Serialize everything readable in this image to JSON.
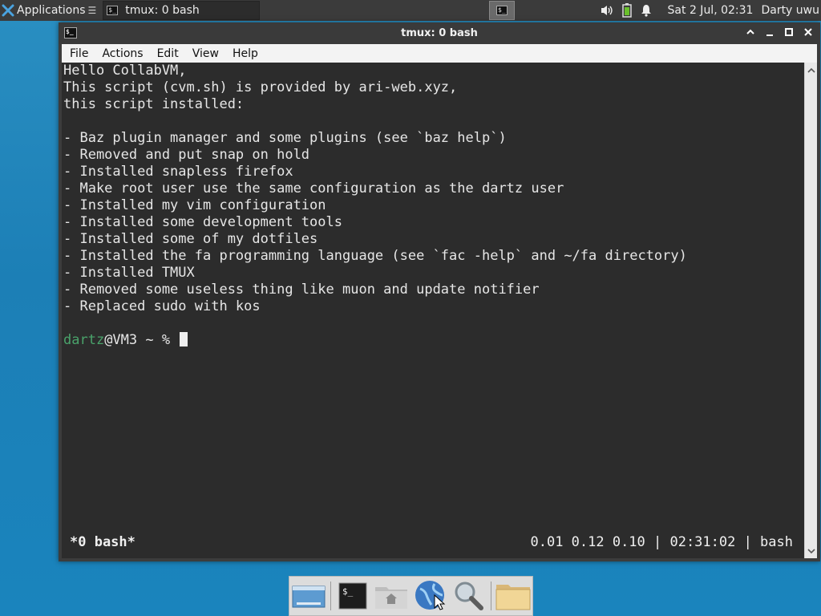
{
  "panel": {
    "applications_label": "Applications",
    "task_label": "tmux: 0 bash",
    "clock": "Sat  2 Jul, 02:31",
    "user": "Darty uwu",
    "tray_icons": [
      "volume-icon",
      "battery-icon",
      "notification-bell-icon"
    ]
  },
  "window": {
    "title": "tmux: 0 bash",
    "controls": [
      "shade-up-icon",
      "minimize-icon",
      "maximize-icon",
      "close-icon"
    ],
    "menu": [
      "File",
      "Actions",
      "Edit",
      "View",
      "Help"
    ]
  },
  "terminal": {
    "lines": [
      "Hello CollabVM,",
      "This script (cvm.sh) is provided by ari-web.xyz,",
      "this script installed:",
      "",
      "- Baz plugin manager and some plugins (see `baz help`)",
      "- Removed and put snap on hold",
      "- Installed snapless firefox",
      "- Make root user use the same configuration as the dartz user",
      "- Installed my vim configuration",
      "- Installed some development tools",
      "- Installed some of my dotfiles",
      "- Installed the fa programming language (see `fac -help` and ~/fa directory)",
      "- Installed TMUX",
      "- Removed some useless thing like muon and update notifier",
      "- Replaced sudo with kos",
      ""
    ],
    "prompt": {
      "user": "dartz",
      "host_path": "@VM3 ~ % "
    },
    "status_left": "*0 bash*",
    "status_right": "0.01 0.12 0.10 | 02:31:02 | bash"
  },
  "dock": {
    "items": [
      "show-desktop-icon",
      "terminal-icon",
      "home-folder-icon",
      "web-browser-icon",
      "search-icon",
      "files-folder-icon"
    ]
  }
}
